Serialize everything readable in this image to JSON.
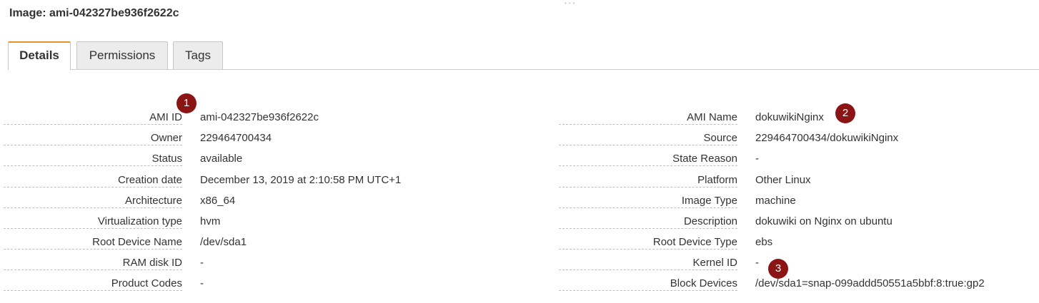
{
  "header": {
    "title": "Image: ami-042327be936f2622c"
  },
  "tabs": [
    {
      "label": "Details",
      "active": true
    },
    {
      "label": "Permissions",
      "active": false
    },
    {
      "label": "Tags",
      "active": false
    }
  ],
  "details_left": [
    {
      "label": "AMI ID",
      "value": "ami-042327be936f2622c"
    },
    {
      "label": "Owner",
      "value": "229464700434"
    },
    {
      "label": "Status",
      "value": "available"
    },
    {
      "label": "Creation date",
      "value": "December 13, 2019 at 2:10:58 PM UTC+1"
    },
    {
      "label": "Architecture",
      "value": "x86_64"
    },
    {
      "label": "Virtualization type",
      "value": "hvm"
    },
    {
      "label": "Root Device Name",
      "value": "/dev/sda1"
    },
    {
      "label": "RAM disk ID",
      "value": "-"
    },
    {
      "label": "Product Codes",
      "value": "-"
    }
  ],
  "details_right": [
    {
      "label": "AMI Name",
      "value": "dokuwikiNginx"
    },
    {
      "label": "Source",
      "value": "229464700434/dokuwikiNginx"
    },
    {
      "label": "State Reason",
      "value": "-"
    },
    {
      "label": "Platform",
      "value": "Other Linux"
    },
    {
      "label": "Image Type",
      "value": "machine"
    },
    {
      "label": "Description",
      "value": "dokuwiki on Nginx on ubuntu"
    },
    {
      "label": "Root Device Type",
      "value": "ebs"
    },
    {
      "label": "Kernel ID",
      "value": "-"
    },
    {
      "label": "Block Devices",
      "value": "/dev/sda1=snap-099addd50551a5bbf:8:true:gp2"
    }
  ],
  "markers": [
    "1",
    "2",
    "3"
  ],
  "colors": {
    "active_tab_accent": "#e8902b",
    "marker": "#8b1414"
  }
}
